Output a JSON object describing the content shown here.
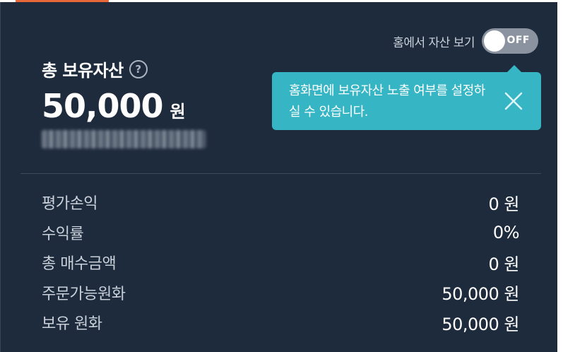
{
  "header": {
    "home_toggle_label": "홈에서 자산 보기",
    "toggle_state": "OFF"
  },
  "summary": {
    "title": "총 보유자산",
    "help_icon": "question-circle-icon",
    "amount": "50,000",
    "unit": "원"
  },
  "tooltip": {
    "text": "홈화면에 보유자산 노출 여부를 설정하실 수 있습니다.",
    "close_icon": "close-icon"
  },
  "rows": [
    {
      "label": "평가손익",
      "value": "0 원"
    },
    {
      "label": "수익률",
      "value": "0%"
    },
    {
      "label": "총 매수금액",
      "value": "0 원"
    },
    {
      "label": "주문가능원화",
      "value": "50,000 원"
    },
    {
      "label": "보유 원화",
      "value": "50,000 원"
    }
  ],
  "colors": {
    "background": "#1d2b3d",
    "tooltip": "#36b6c5",
    "accent": "#e8683a",
    "toggle_off": "#8a939f"
  }
}
